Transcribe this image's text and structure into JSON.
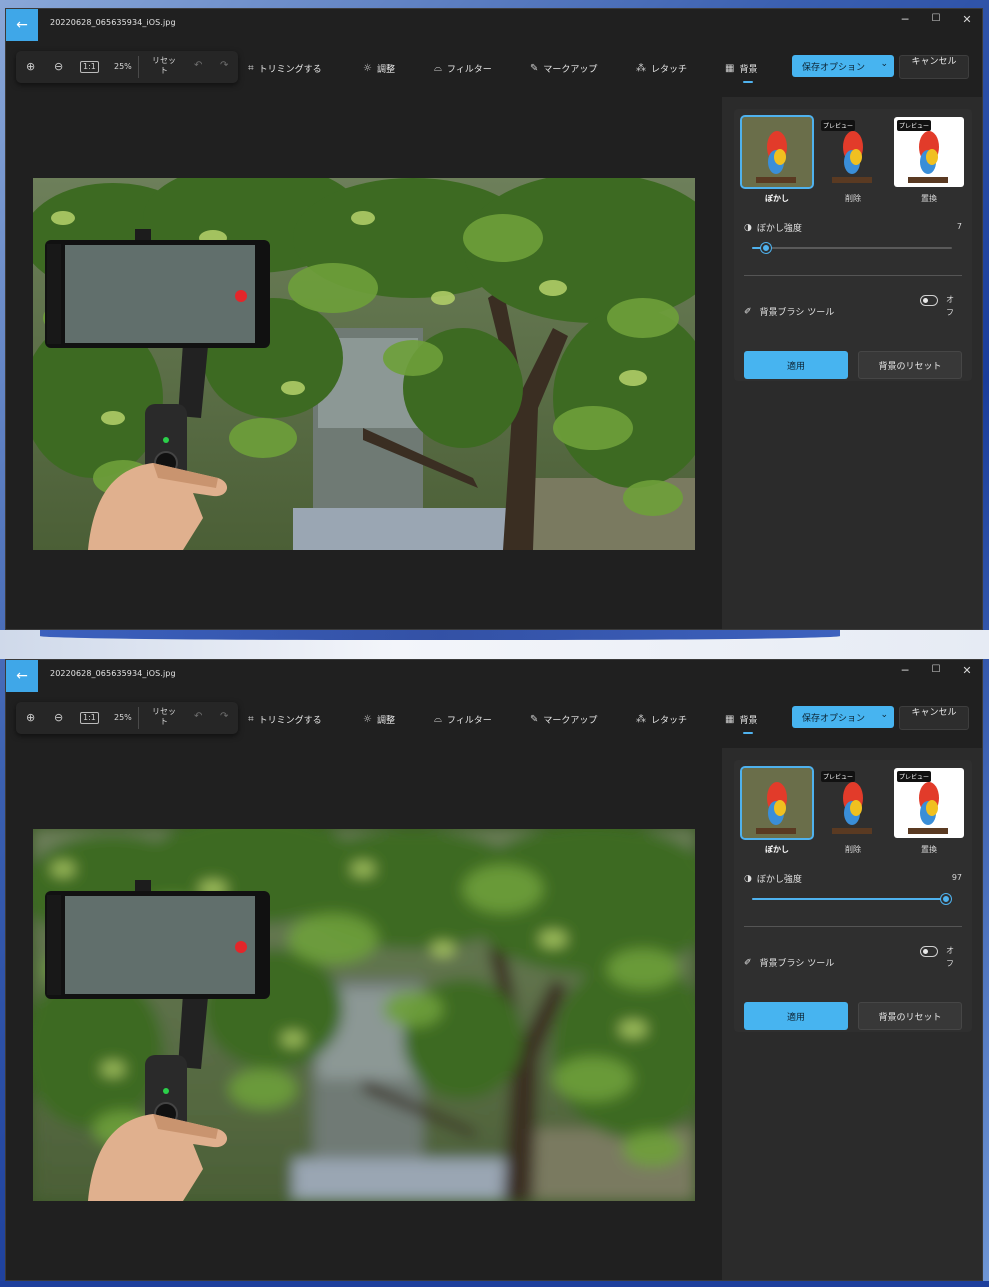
{
  "windows": [
    {
      "title_filename": "20220628_065635934_iOS.jpg",
      "zoom": "25%",
      "reset_label": "リセット",
      "tools": {
        "crop": "トリミングする",
        "adjust": "調整",
        "filter": "フィルター",
        "markup": "マークアップ",
        "retouch": "レタッチ",
        "background": "背景"
      },
      "save_options": "保存オプション",
      "cancel": "キャンセル",
      "panel": {
        "options": [
          {
            "label": "ぼかし",
            "badge": ""
          },
          {
            "label": "削除",
            "badge": "プレビュー"
          },
          {
            "label": "置換",
            "badge": "プレビュー"
          }
        ],
        "blur_strength_label": "ぼかし強度",
        "blur_strength_value": "7",
        "blur_strength_fraction": 0.07,
        "brush_tool_label": "背景ブラシ ツール",
        "toggle_label": "オフ",
        "apply": "適用",
        "reset_background": "背景のリセット"
      },
      "photo_blurred": false
    },
    {
      "title_filename": "20220628_065635934_iOS.jpg",
      "zoom": "25%",
      "reset_label": "リセット",
      "tools": {
        "crop": "トリミングする",
        "adjust": "調整",
        "filter": "フィルター",
        "markup": "マークアップ",
        "retouch": "レタッチ",
        "background": "背景"
      },
      "save_options": "保存オプション",
      "cancel": "キャンセル",
      "panel": {
        "options": [
          {
            "label": "ぼかし",
            "badge": ""
          },
          {
            "label": "削除",
            "badge": "プレビュー"
          },
          {
            "label": "置換",
            "badge": "プレビュー"
          }
        ],
        "blur_strength_label": "ぼかし強度",
        "blur_strength_value": "97",
        "blur_strength_fraction": 0.97,
        "brush_tool_label": "背景ブラシ ツール",
        "toggle_label": "オフ",
        "apply": "適用",
        "reset_background": "背景のリセット"
      },
      "photo_blurred": true
    }
  ],
  "icons": {
    "back": "back-arrow-icon",
    "zoom_in": "zoom-in-icon",
    "zoom_out": "zoom-out-icon",
    "actual_size": "actual-size-icon",
    "undo": "undo-icon",
    "redo": "redo-icon",
    "crop": "crop-icon",
    "adjust": "brightness-icon",
    "filter": "filter-icon",
    "markup": "pen-icon",
    "retouch": "retouch-icon",
    "background": "background-icon",
    "blur_strength": "contrast-icon",
    "brush": "brush-icon"
  },
  "colors": {
    "accent": "#47b4f0",
    "window_bg": "#202020",
    "panel_bg": "#2b2b2b"
  }
}
